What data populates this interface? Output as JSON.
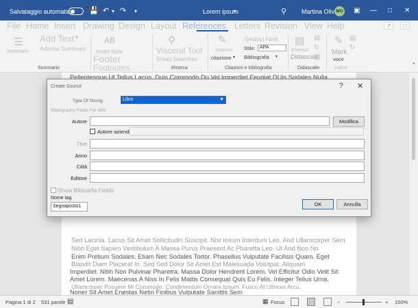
{
  "titlebar": {
    "autosave_label": "Salvataggio automatico",
    "doc_title": "Lorem ipsum",
    "user_name": "Martina Oliva",
    "user_initials": "MO"
  },
  "ribbon_tabs": [
    "File",
    "Home",
    "Insert",
    "Drawing",
    "Design",
    "Layout",
    "References",
    "Letters",
    "Revision",
    "View",
    "Help"
  ],
  "ribbon": {
    "sommario": "Sommario",
    "add_text": "Add Text",
    "update_toc": "Adioma Summary",
    "insert_note": "Insert Note",
    "footer": "Footer",
    "footnotes": "Footnotes",
    "ab_label": "AB",
    "visual_tool": "Visceral Tool",
    "smart_searches": "Smarj Searches",
    "insert_citation": "Inserisci",
    "citation": "citazione",
    "manage_sources": "Gestisci Fonti",
    "style_label": "Stile:",
    "style_value": "APA",
    "bibliography": "Bibliografia",
    "insert_caption": "Inserisci",
    "didascalia_btn": "Didascali",
    "mark_entry": "Mark",
    "voce": "voce",
    "groups": {
      "sommario": "Sommario",
      "ricerca": "Ricerca",
      "citazioni": "Citazioni e bibliografia",
      "didascalie": "Didascalie",
      "indice": "Indice"
    }
  },
  "document": {
    "top_line": "Pellentesque Ut Tellus Lacus. Duis Commodo Du Vel Imperdiet Feugiat DUis Sodales Nulla",
    "para1": [
      "Sed Lacinia. Lacus Sit Amet Sollicitudin Suscipit. Nisl Iosum Interdum Leo. And Ullamcorper Sem",
      "Nibh Eget Sapien Vestibulum A Massa Purus Praesent Ac Pharetta Leo. Ut And Non No",
      "Enim Pretium Sodales. Etiam Nec Sodales Tortor. Phasellus Vulputate Facilisis Quam. Eget",
      "Blandit Diam Placerat In. Sed Sed Dolor Sit Amet Est Malesuada Volutpat. Aliquam"
    ],
    "para2": [
      "Imperdiet. Nibh Non Pulvinar Pharetra. Massa Dolor Hendrerit Lorem. Vel Efficitur Odio Velit Sit",
      "Amet Lorem. Maecenas A Niss In Felis Mattis Consequat Quis Eu Felis. Integer Tellus Urna.",
      "Ullamcorper Posuere Mi Commodo. Condimentum Ornare Ipsum. Fusco At Ultrices Arcu.",
      "Noner Sit Amet Enestas Netin Finibus Vulputate Sanittis Sem"
    ]
  },
  "dialog": {
    "title": "Create Source",
    "help": "?",
    "type_label": "Type Of Strong",
    "type_value": "Libro",
    "fields_header": "Bibliography Fields For APA",
    "author_label": "Autore",
    "author_value": "",
    "edit_button": "Modifica",
    "corporate_author_label": "Autore azienda",
    "title_label": "Thet",
    "year_label": "Anno",
    "city_label": "Città",
    "publisher_label": "Editore",
    "show_all_label": "Show Bibloarfa Fields",
    "tag_label": "Nome tag",
    "tag_value": "Segnaposto1",
    "ok_button": "OK",
    "cancel_button": "Annulla"
  },
  "statusbar": {
    "page": "Pagina 1 di 2",
    "words": "531 parole",
    "focus": "Focus",
    "zoom": "100%"
  }
}
